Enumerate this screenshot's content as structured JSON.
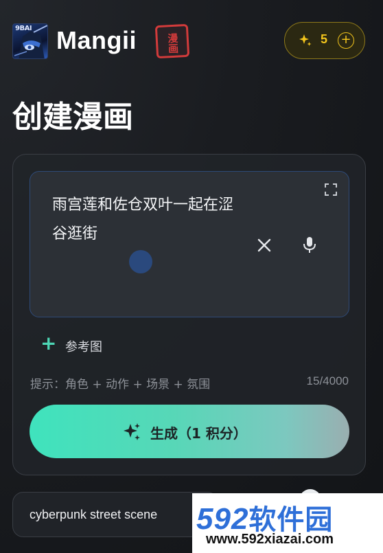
{
  "header": {
    "app_title": "Mangii",
    "logo_tag": "9BAI",
    "stamp_text": "漫画",
    "credits": {
      "count": "5",
      "plus": "+"
    }
  },
  "page": {
    "title": "创建漫画"
  },
  "prompt": {
    "text": "雨宫莲和佐仓双叶一起在涩谷逛街"
  },
  "reference": {
    "plus": "+",
    "label": "参考图"
  },
  "hint": {
    "text": "提示：角色 + 动作 + 场景 + 氛围",
    "count": "15/4000"
  },
  "generate": {
    "label": "生成（1 积分）"
  },
  "suggestions": [
    {
      "label": "cyberpunk street scene"
    }
  ],
  "watermark": {
    "brand_num": "592",
    "brand_cn": "软件园",
    "url": "www.592xiazai.com"
  },
  "colors": {
    "accent": "#4dd6b5",
    "credit_gold": "#f3c51c",
    "stamp_red": "#d23b3b",
    "background": "#1a1c20"
  },
  "icons": {
    "credits": "sparkle-icon",
    "expand": "expand-icon",
    "clear": "close-icon",
    "mic": "microphone-icon",
    "generate": "sparkle-icon"
  }
}
